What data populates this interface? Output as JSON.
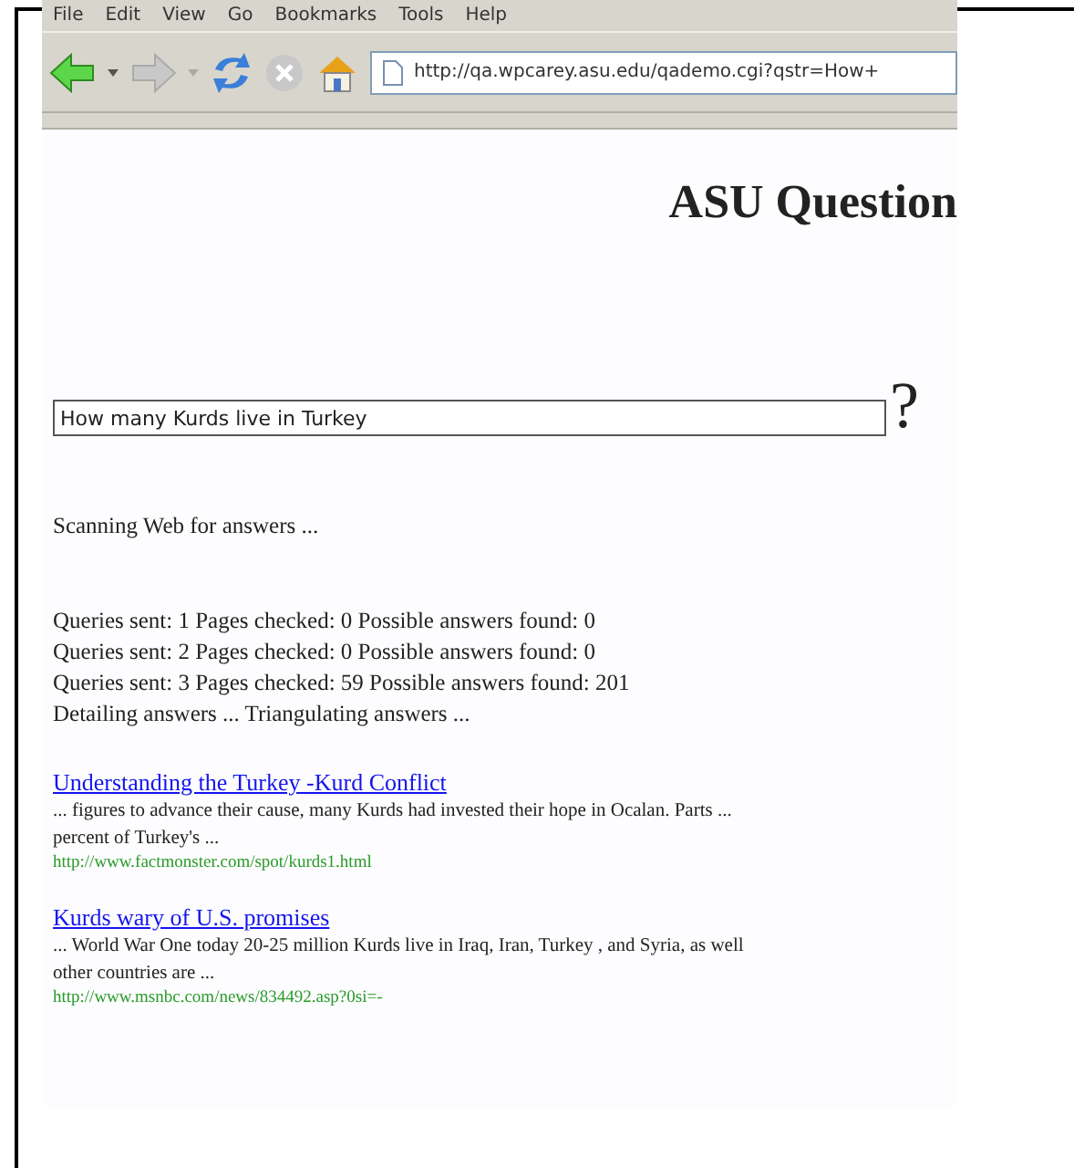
{
  "menu": [
    "File",
    "Edit",
    "View",
    "Go",
    "Bookmarks",
    "Tools",
    "Help"
  ],
  "toolbar": {
    "address": "http://qa.wpcarey.asu.edu/qademo.cgi?qstr=How+"
  },
  "page": {
    "title": "ASU Question",
    "question": {
      "value": "How many Kurds live in Turkey",
      "mark": "?"
    },
    "status": "Scanning Web for answers ...",
    "progress": [
      "Queries sent: 1 Pages checked: 0 Possible answers found: 0",
      "Queries sent: 2 Pages checked: 0 Possible answers found: 0",
      "Queries sent: 3 Pages checked: 59 Possible answers found: 201",
      "Detailing answers ... Triangulating answers ..."
    ],
    "results": [
      {
        "title": "Understanding the Turkey -Kurd Conflict",
        "snippet": [
          "... figures to advance their cause, many Kurds had invested their hope in Ocalan. Parts ...",
          "percent of Turkey's ..."
        ],
        "url": "http://www.factmonster.com/spot/kurds1.html"
      },
      {
        "title": "Kurds wary of U.S. promises",
        "snippet": [
          "... World War One today 20-25 million Kurds live in Iraq, Iran, Turkey , and Syria, as well",
          "other countries are ..."
        ],
        "url": "http://www.msnbc.com/news/834492.asp?0si=-"
      }
    ]
  }
}
